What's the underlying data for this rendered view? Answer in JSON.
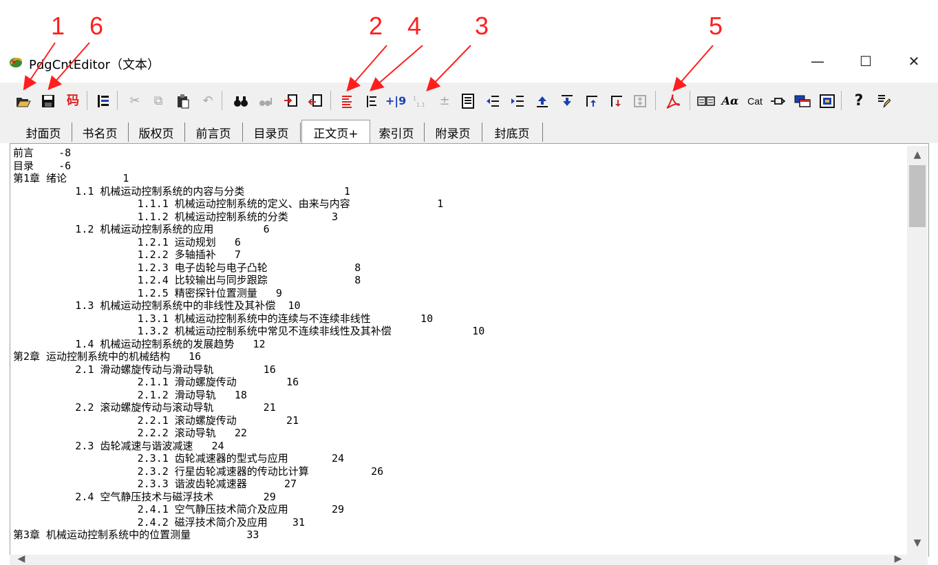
{
  "annotations": [
    "1",
    "6",
    "2",
    "4",
    "3",
    "5"
  ],
  "window": {
    "title": "PdgCntEditor（文本）",
    "minimize": "—",
    "maximize": "☐",
    "close": "✕"
  },
  "toolbar": {
    "code_label": "码",
    "number9_label": "+|9",
    "cat_label": "Cat",
    "aa_label": "Aα",
    "help_label": "?",
    "colors": {
      "red": "#e02020",
      "blue": "#1a3fb5",
      "dark": "#1a1a1a",
      "disabled": "#a8a8a8"
    }
  },
  "tabs": [
    "封面页",
    "书名页",
    "版权页",
    "前言页",
    "目录页",
    "正文页+",
    "索引页",
    "附录页",
    "封底页"
  ],
  "active_tab": "正文页+",
  "editor": {
    "lines": [
      "前言    -8",
      "目录    -6",
      "第1章 绪论         1",
      "          1.1 机械运动控制系统的内容与分类                1",
      "                    1.1.1 机械运动控制系统的定义、由来与内容              1",
      "                    1.1.2 机械运动控制系统的分类       3",
      "          1.2 机械运动控制系统的应用        6",
      "                    1.2.1 运动规划   6",
      "                    1.2.2 多轴插补   7",
      "                    1.2.3 电子齿轮与电子凸轮              8",
      "                    1.2.4 比较输出与同步跟踪              8",
      "                    1.2.5 精密探针位置测量   9",
      "          1.3 机械运动控制系统中的非线性及其补偿  10",
      "                    1.3.1 机械运动控制系统中的连续与不连续非线性        10",
      "                    1.3.2 机械运动控制系统中常见不连续非线性及其补偿             10",
      "          1.4 机械运动控制系统的发展趋势   12",
      "第2章 运动控制系统中的机械结构   16",
      "          2.1 滑动螺旋传动与滑动导轨        16",
      "                    2.1.1 滑动螺旋传动        16",
      "                    2.1.2 滑动导轨   18",
      "          2.2 滚动螺旋传动与滚动导轨        21",
      "                    2.2.1 滚动螺旋传动        21",
      "                    2.2.2 滚动导轨   22",
      "          2.3 齿轮减速与谐波减速   24",
      "                    2.3.1 齿轮减速器的型式与应用       24",
      "                    2.3.2 行星齿轮减速器的传动比计算          26",
      "                    2.3.3 谐波齿轮减速器      27",
      "          2.4 空气静压技术与磁浮技术        29",
      "                    2.4.1 空气静压技术简介及应用       29",
      "                    2.4.2 磁浮技术简介及应用    31",
      "第3章 机械运动控制系统中的位置测量         33"
    ]
  }
}
